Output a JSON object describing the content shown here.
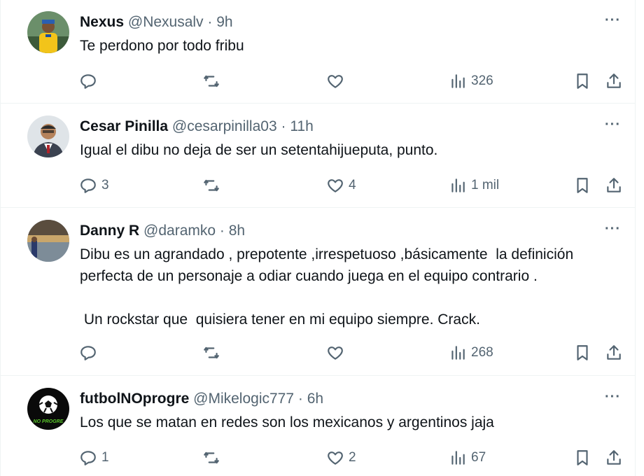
{
  "posts": [
    {
      "name": "Nexus",
      "handle": "@Nexusalv",
      "time": "9h",
      "text": "Te perdono por todo fribu",
      "replies": "",
      "retweets": "",
      "likes": "",
      "views": "326"
    },
    {
      "name": "Cesar Pinilla",
      "handle": "@cesarpinilla03",
      "time": "11h",
      "text": "Igual el dibu no deja de ser un setentahijueputa, punto.",
      "replies": "3",
      "retweets": "",
      "likes": "4",
      "views": "1 mil"
    },
    {
      "name": "Danny R",
      "handle": "@daramko",
      "time": "8h",
      "text": "Dibu es un agrandado , prepotente ,irrespetuoso ,básicamente  la definición perfecta de un personaje a odiar cuando juega en el equipo contrario .\n\n Un rockstar que  quisiera tener en mi equipo siempre. Crack.",
      "replies": "",
      "retweets": "",
      "likes": "",
      "views": "268"
    },
    {
      "name": "futbolNOprogre",
      "handle": "@Mikelogic777",
      "time": "6h",
      "text": "Los que se matan en redes son los mexicanos y argentinos jaja",
      "replies": "1",
      "retweets": "",
      "likes": "2",
      "views": "67",
      "avatar_text": "NO PROGRE"
    }
  ],
  "more_label": "···",
  "separator": " · ",
  "colors": {
    "text": "#0f1419",
    "muted": "#536471",
    "border": "#eff3f4"
  }
}
